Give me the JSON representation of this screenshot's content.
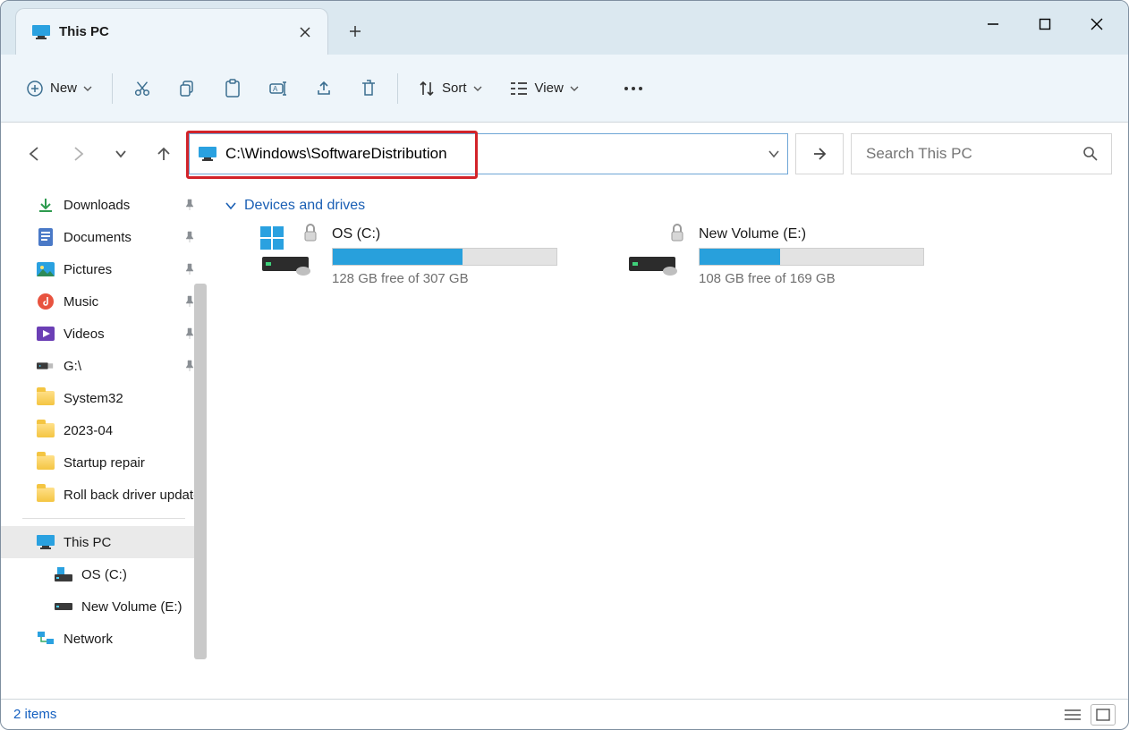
{
  "tab": {
    "title": "This PC"
  },
  "toolbar": {
    "new_label": "New",
    "sort_label": "Sort",
    "view_label": "View"
  },
  "address": {
    "value": "C:\\Windows\\SoftwareDistribution"
  },
  "search": {
    "placeholder": "Search This PC"
  },
  "nav": {
    "quick": [
      {
        "label": "Downloads",
        "icon": "download",
        "pinned": true
      },
      {
        "label": "Documents",
        "icon": "doc",
        "pinned": true
      },
      {
        "label": "Pictures",
        "icon": "pic",
        "pinned": true
      },
      {
        "label": "Music",
        "icon": "music",
        "pinned": true
      },
      {
        "label": "Videos",
        "icon": "video",
        "pinned": true
      },
      {
        "label": "G:\\",
        "icon": "usb",
        "pinned": true
      },
      {
        "label": "System32",
        "icon": "folder",
        "pinned": false
      },
      {
        "label": "2023-04",
        "icon": "folder",
        "pinned": false
      },
      {
        "label": "Startup repair",
        "icon": "folder",
        "pinned": false
      },
      {
        "label": "Roll back driver update",
        "icon": "folder",
        "pinned": false
      }
    ],
    "pc": {
      "label": "This PC"
    },
    "pc_children": [
      {
        "label": "OS (C:)",
        "icon": "disk-win"
      },
      {
        "label": "New Volume (E:)",
        "icon": "disk"
      }
    ],
    "network": {
      "label": "Network"
    }
  },
  "group": {
    "header": "Devices and drives"
  },
  "drives": [
    {
      "name": "OS (C:)",
      "free_text": "128 GB free of 307 GB",
      "fill_pct": 58,
      "system": true
    },
    {
      "name": "New Volume (E:)",
      "free_text": "108 GB free of 169 GB",
      "fill_pct": 36,
      "system": false
    }
  ],
  "status": {
    "text": "2 items"
  }
}
